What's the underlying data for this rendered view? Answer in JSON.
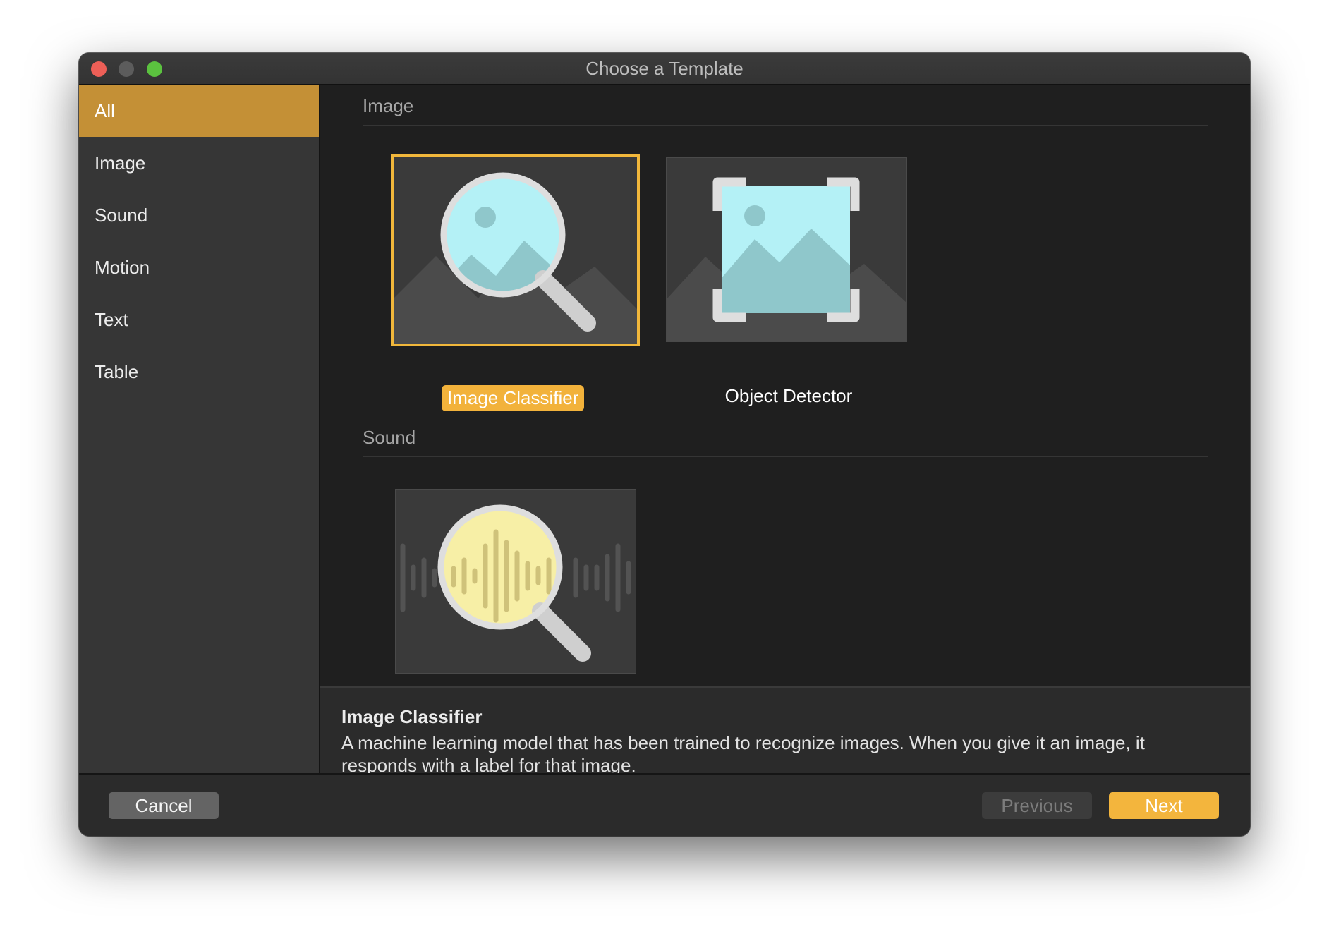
{
  "window": {
    "title": "Choose a Template"
  },
  "sidebar": {
    "items": [
      {
        "label": "All",
        "selected": true
      },
      {
        "label": "Image"
      },
      {
        "label": "Sound"
      },
      {
        "label": "Motion"
      },
      {
        "label": "Text"
      },
      {
        "label": "Table"
      }
    ]
  },
  "sections": [
    {
      "title": "Image",
      "templates": [
        {
          "label": "Image Classifier",
          "selected": true,
          "icon": "magnifier-image-icon"
        },
        {
          "label": "Object Detector",
          "icon": "object-detector-frame-icon"
        }
      ]
    },
    {
      "title": "Sound",
      "templates": [
        {
          "label": "",
          "icon": "magnifier-waveform-icon"
        }
      ]
    }
  ],
  "description": {
    "title": "Image Classifier",
    "text": "A machine learning model that has been trained to recognize images. When you give it an image, it responds with a label for that image."
  },
  "footer": {
    "cancel_label": "Cancel",
    "previous_label": "Previous",
    "next_label": "Next"
  },
  "colors": {
    "accent": "#f2b23b",
    "sidebar_selected": "#c49036",
    "window_bg": "#1f1f1f",
    "sidebar_bg": "#363636"
  }
}
